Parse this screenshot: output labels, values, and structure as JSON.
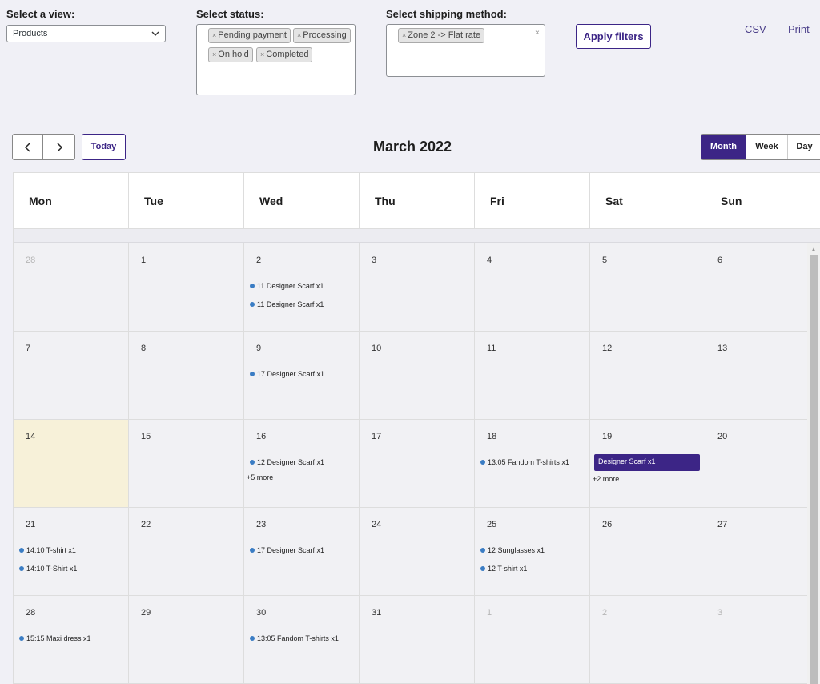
{
  "filters": {
    "view_label": "Select a view:",
    "view_value": "Products",
    "status_label": "Select status:",
    "status_tags": [
      "Pending payment",
      "Processing",
      "On hold",
      "Completed"
    ],
    "shipping_label": "Select shipping method:",
    "shipping_tags": [
      "Zone 2 -> Flat rate"
    ],
    "clear_symbol": "×",
    "tag_remove_symbol": "×",
    "apply_label": "Apply filters"
  },
  "links": {
    "csv": "CSV",
    "print": "Print"
  },
  "toolbar": {
    "today_label": "Today",
    "title": "March 2022",
    "views": [
      "Month",
      "Week",
      "Day"
    ],
    "active_view": "Month"
  },
  "calendar": {
    "weekdays": [
      "Mon",
      "Tue",
      "Wed",
      "Thu",
      "Fri",
      "Sat",
      "Sun"
    ],
    "weeks": [
      [
        "28",
        "1",
        "2",
        "3",
        "4",
        "5",
        "6"
      ],
      [
        "7",
        "8",
        "9",
        "10",
        "11",
        "12",
        "13"
      ],
      [
        "14",
        "15",
        "16",
        "17",
        "18",
        "19",
        "20"
      ],
      [
        "21",
        "22",
        "23",
        "24",
        "25",
        "26",
        "27"
      ],
      [
        "28",
        "29",
        "30",
        "31",
        "1",
        "2",
        "3"
      ]
    ],
    "events": {
      "w0_wed_1": "11 Designer Scarf x1",
      "w0_wed_2": "11 Designer Scarf x1",
      "w1_wed_1": "17 Designer Scarf x1",
      "w2_wed_1": "12 Designer Scarf x1",
      "w2_wed_more": "+5 more",
      "w2_fri_1": "13:05 Fandom T-shirts x1",
      "w2_sat_block": "Designer Scarf x1",
      "w2_sat_more": "+2 more",
      "w3_mon_1": "14:10 T-shirt x1",
      "w3_mon_2": "14:10 T-Shirt x1",
      "w3_wed_1": "17 Designer Scarf x1",
      "w3_fri_1": "12 Sunglasses x1",
      "w3_fri_2": "12 T-shirt x1",
      "w4_mon_1": "15:15 Maxi dress x1",
      "w4_wed_1": "13:05 Fandom T-shirts x1"
    }
  },
  "colors": {
    "accent": "#3c2586",
    "event_dot": "#3b7dc4",
    "today_bg": "#f7f1d9",
    "page_bg": "#f0f0f6"
  }
}
